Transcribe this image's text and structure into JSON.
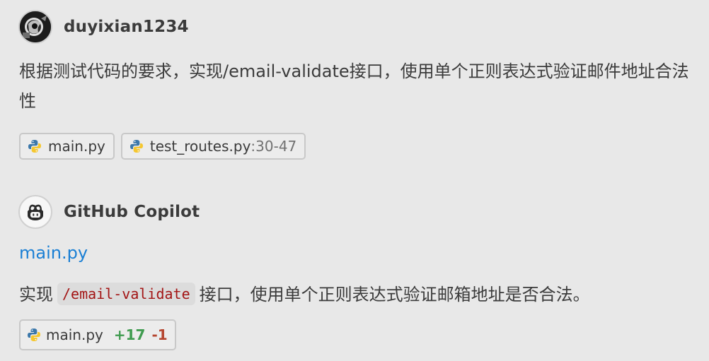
{
  "user_message": {
    "author": "duyixian1234",
    "avatar_icon": "user-avatar",
    "text": "根据测试代码的要求，实现/email-validate接口，使用单个正则表达式验证邮件地址合法性",
    "references": [
      {
        "icon": "python-file-icon",
        "name": "main.py",
        "range": ""
      },
      {
        "icon": "python-file-icon",
        "name": "test_routes.py",
        "range": ":30-47"
      }
    ]
  },
  "assistant_message": {
    "author": "GitHub Copilot",
    "avatar_icon": "copilot-icon",
    "file_link": "main.py",
    "text_before": "实现",
    "code": "/email-validate",
    "text_after": "接口，使用单个正则表达式验证邮箱地址是否合法。",
    "edit": {
      "icon": "python-file-icon",
      "file": "main.py",
      "added": "+17",
      "removed": "-1"
    }
  },
  "colors": {
    "background": "#e8e8e8",
    "link": "#1a7fd4",
    "added": "#3f9b4f",
    "removed": "#b5452f",
    "code": "#a31515"
  }
}
